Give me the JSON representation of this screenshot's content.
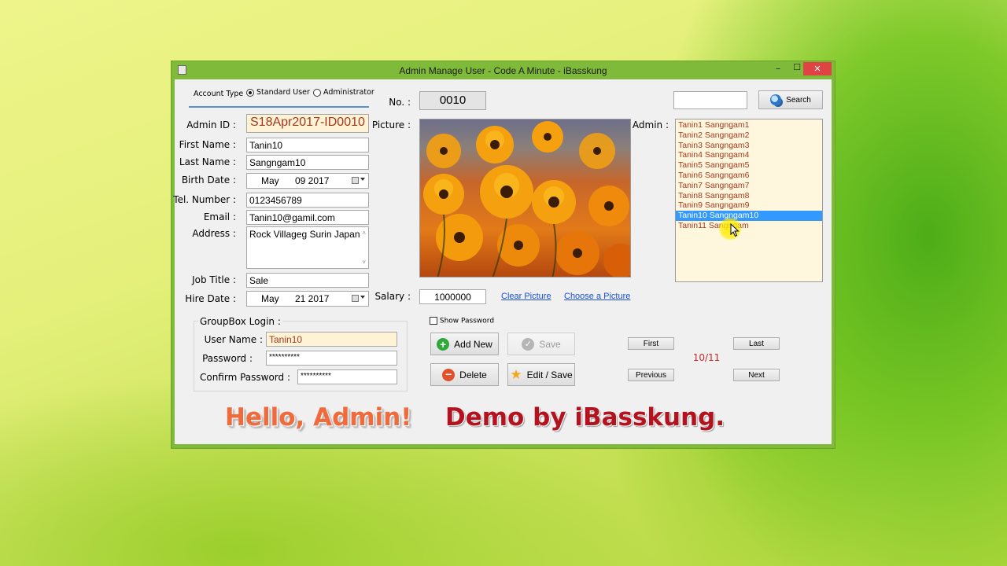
{
  "window": {
    "title": "Admin Manage User - Code A Minute - iBasskung",
    "controls": {
      "minimize": "–",
      "maximize": "☐",
      "close": "✕"
    }
  },
  "account_type": {
    "label": "Account Type",
    "options": [
      "Standard User",
      "Administrator"
    ],
    "selected": "Standard User"
  },
  "form": {
    "admin_id_label": "Admin ID :",
    "admin_id": "S18Apr2017-ID0010",
    "first_name_label": "First Name :",
    "first_name": "Tanin10",
    "last_name_label": "Last Name :",
    "last_name": "Sangngam10",
    "birth_date_label": "Birth Date :",
    "birth_month": "May",
    "birth_day_year": "09 2017",
    "tel_label": "Tel. Number :",
    "tel": "0123456789",
    "email_label": "Email :",
    "email": "Tanin10@gamil.com",
    "address_label": "Address :",
    "address": "Rock Villageg Surin Japan",
    "job_title_label": "Job Title :",
    "job_title": "Sale",
    "hire_date_label": "Hire Date :",
    "hire_month": "May",
    "hire_day_year": "21 2017"
  },
  "record": {
    "no_label": "No. :",
    "no": "0010",
    "picture_label": "Picture :",
    "salary_label": "Salary :",
    "salary": "1000000",
    "clear_picture": "Clear Picture",
    "choose_picture": "Choose a Picture"
  },
  "search": {
    "value": "",
    "button": "Search"
  },
  "admin_list": {
    "label": "Admin :",
    "items": [
      "Tanin1 Sangngam1",
      "Tanin2 Sangngam2",
      "Tanin3 Sangngam3",
      "Tanin4 Sangngam4",
      "Tanin5 Sangngam5",
      "Tanin6 Sangngam6",
      "Tanin7 Sangngam7",
      "Tanin8 Sangngam8",
      "Tanin9 Sangngam9",
      "Tanin10 Sangngam10",
      "Tanin11 Sangngam"
    ],
    "selected_index": 9
  },
  "login": {
    "group_title": "GroupBox Login :",
    "username_label": "User Name :",
    "username": "Tanin10",
    "password_label": "Password :",
    "password": "**********",
    "confirm_label": "Confirm Password :",
    "confirm": "**********",
    "show_password": "Show Password"
  },
  "actions": {
    "add_new": "Add New",
    "save": "Save",
    "delete": "Delete",
    "edit_save": "Edit / Save"
  },
  "navigation": {
    "first": "First",
    "last": "Last",
    "previous": "Previous",
    "next": "Next",
    "position": "10/11"
  },
  "banner": {
    "hello": "Hello, Admin!",
    "demo": "Demo by iBasskung."
  },
  "colors": {
    "title_bar": "#7fba3a",
    "close": "#e04343",
    "list_bg": "#fff7dd",
    "list_text": "#a5371f",
    "selection": "#3399ff",
    "admin_id_text": "#a5371f",
    "banner_red": "#b3121e",
    "banner_orange": "#f06a3c"
  }
}
